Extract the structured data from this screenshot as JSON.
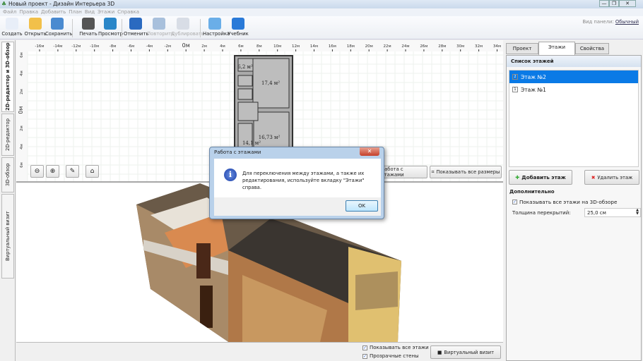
{
  "window": {
    "title": "Новый проект - Дизайн Интерьера 3D",
    "minimize": "—",
    "restore": "❐",
    "close": "✕"
  },
  "menu": [
    "Файл",
    "Правка",
    "Добавить",
    "План",
    "Вид",
    "Этажи",
    "Справка"
  ],
  "toolbar": [
    {
      "label": "Создать",
      "icon": "new-file-icon",
      "color": "#e8eef8"
    },
    {
      "label": "Открыть",
      "icon": "folder-icon",
      "color": "#f2c04a"
    },
    {
      "label": "Сохранить",
      "icon": "save-icon",
      "color": "#4a8ad0"
    },
    {
      "label": "Печать",
      "icon": "printer-icon",
      "color": "#555"
    },
    {
      "label": "Просмотр",
      "icon": "monitor-icon",
      "color": "#2a86c8"
    },
    {
      "label": "Отменить",
      "icon": "undo-icon",
      "color": "#2a6ac0"
    },
    {
      "label": "Повторить",
      "icon": "redo-icon",
      "color": "#a8c0dc",
      "disabled": true
    },
    {
      "label": "Дублировать",
      "icon": "duplicate-icon",
      "color": "#d8dde6",
      "disabled": true
    },
    {
      "label": "Настройка",
      "icon": "gear-icon",
      "color": "#6aaee8"
    },
    {
      "label": "Учебник",
      "icon": "help-icon",
      "color": "#2a7ad8"
    }
  ],
  "view_mode": {
    "label": "Вид панели:",
    "value": "Обычный"
  },
  "left_tabs": [
    "2D-редактор и 3D-обзор",
    "2D-редактор",
    "3D-обзор",
    "Виртуальный визит"
  ],
  "plan": {
    "ruler_x": [
      "-16м",
      "-14м",
      "-12м",
      "-10м",
      "-8м",
      "-6м",
      "-4м",
      "-2м",
      "0м",
      "2м",
      "4м",
      "6м",
      "8м",
      "10м",
      "12м",
      "14м",
      "16м",
      "18м",
      "20м",
      "22м",
      "24м",
      "26м",
      "28м",
      "30м",
      "32м",
      "34м"
    ],
    "ruler_y": [
      "6м",
      "4м",
      "2м",
      "0м",
      "2м",
      "4м",
      "6м"
    ],
    "rooms": [
      "6,2 м²",
      "17,4 м²",
      "16,73 м²",
      "14,1 м²"
    ],
    "floors_button": "Работа с этажами",
    "show_sizes_button": "Показывать все размеры"
  },
  "bottom": {
    "show_all_floors": "Показывать все этажи",
    "transparent_walls": "Прозрачные стены",
    "virtual_visit": "Виртуальный визит"
  },
  "right": {
    "tabs": [
      "Проект",
      "Этажи",
      "Свойства"
    ],
    "active_tab": "Этажи",
    "list_title": "Список этажей",
    "floors": [
      {
        "label": "Этаж №2",
        "num": "2",
        "selected": true
      },
      {
        "label": "Этаж №1",
        "num": "1",
        "selected": false
      }
    ],
    "add_floor": "Добавить этаж",
    "delete_floor": "Удалить этаж",
    "extra_title": "Дополнительно",
    "show_all_3d": "Показывать все этажи на 3D-обзоре",
    "thickness_label": "Толщина перекрытий:",
    "thickness_value": "25,0 см"
  },
  "dialog": {
    "title": "Работа с этажами",
    "message": "Для переключения между этажами, а также их редактирования, используйте вкладку \"Этажи\" справа.",
    "ok": "OK"
  }
}
